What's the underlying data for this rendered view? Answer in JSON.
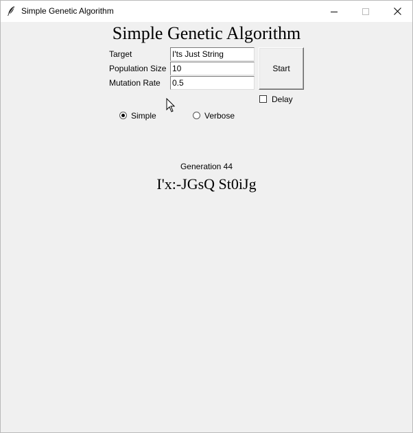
{
  "window": {
    "title": "Simple Genetic Algorithm",
    "icon": "feather-icon",
    "controls": {
      "minimize": "minimize-icon",
      "maximize": "maximize-icon",
      "close": "close-icon"
    }
  },
  "app": {
    "heading": "Simple Genetic Algorithm"
  },
  "form": {
    "target_label": "Target",
    "target_value": "I'ts Just String",
    "population_label": "Population Size",
    "population_value": "10",
    "mutation_label": "Mutation Rate",
    "mutation_value": "0.5",
    "start_label": "Start",
    "delay_label": "Delay",
    "delay_checked": false
  },
  "mode": {
    "simple_label": "Simple",
    "verbose_label": "Verbose",
    "selected": "Simple"
  },
  "output": {
    "generation": "Generation 44",
    "best": "I'x:-JGsQ St0iJg"
  }
}
